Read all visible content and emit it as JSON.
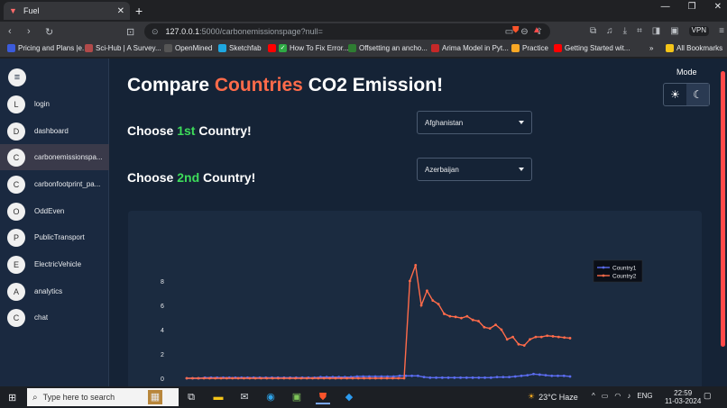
{
  "browser": {
    "tab_title": "Fuel",
    "url_host": "127.0.0.1",
    "url_rest": ":5000/carbonemissionspage?null=",
    "bookmarks": [
      "Pricing and Plans |e...",
      "Sci-Hub | A Survey...",
      "OpenMined",
      "Sketchfab",
      "How To Fix Error...",
      "Offsetting an ancho...",
      "Arima Model in Pyt...",
      "Practice",
      "Getting Started wit..."
    ],
    "all_bookmarks": "All Bookmarks",
    "vpn": "VPN"
  },
  "sidebar": {
    "items": [
      {
        "initial": "L",
        "label": "login"
      },
      {
        "initial": "D",
        "label": "dashboard"
      },
      {
        "initial": "C",
        "label": "carbonemissionspa..."
      },
      {
        "initial": "C",
        "label": "carbonfootprint_pa..."
      },
      {
        "initial": "O",
        "label": "OddEven"
      },
      {
        "initial": "P",
        "label": "PublicTransport"
      },
      {
        "initial": "E",
        "label": "ElectricVehicle"
      },
      {
        "initial": "A",
        "label": "analytics"
      },
      {
        "initial": "C",
        "label": "chat"
      }
    ]
  },
  "header": {
    "title_prefix": "Compare ",
    "title_highlight": "Countries",
    "title_suffix": " CO2 Emission!"
  },
  "choose1": {
    "prefix": "Choose ",
    "highlight": "1st",
    "suffix": " Country!",
    "selected": "Afghanistan"
  },
  "choose2": {
    "prefix": "Choose ",
    "highlight": "2nd",
    "suffix": " Country!",
    "selected": "Azerbaijan"
  },
  "mode": {
    "label": "Mode"
  },
  "chart_data": {
    "type": "line",
    "yticks": [
      "0",
      "2",
      "4",
      "6",
      "8"
    ],
    "ylim": [
      0,
      10
    ],
    "series": [
      {
        "name": "Country1",
        "color": "#5b6cf0",
        "values": [
          0.0,
          0.0,
          0.0,
          0.05,
          0.05,
          0.05,
          0.05,
          0.05,
          0.05,
          0.05,
          0.05,
          0.05,
          0.05,
          0.05,
          0.05,
          0.05,
          0.05,
          0.05,
          0.05,
          0.05,
          0.05,
          0.05,
          0.1,
          0.1,
          0.1,
          0.1,
          0.1,
          0.1,
          0.15,
          0.15,
          0.15,
          0.15,
          0.15,
          0.15,
          0.15,
          0.2,
          0.2,
          0.2,
          0.2,
          0.1,
          0.05,
          0.05,
          0.05,
          0.05,
          0.05,
          0.05,
          0.05,
          0.05,
          0.05,
          0.05,
          0.05,
          0.1,
          0.1,
          0.1,
          0.15,
          0.2,
          0.25,
          0.35,
          0.3,
          0.25,
          0.2,
          0.2,
          0.2,
          0.15
        ]
      },
      {
        "name": "Country2",
        "color": "#ff6b4a",
        "values": [
          0.0,
          0.0,
          0.0,
          0.0,
          0.0,
          0.0,
          0.0,
          0.0,
          0.0,
          0.0,
          0.0,
          0.0,
          0.0,
          0.0,
          0.0,
          0.0,
          0.0,
          0.0,
          0.0,
          0.0,
          0.0,
          0.0,
          0.0,
          0.0,
          0.0,
          0.0,
          0.0,
          0.0,
          0.0,
          0.0,
          0.0,
          0.0,
          0.0,
          0.0,
          0.0,
          0.0,
          0.0,
          0.0,
          0.0,
          8.0,
          9.3,
          6.0,
          7.2,
          6.4,
          6.1,
          5.3,
          5.1,
          5.05,
          4.95,
          5.1,
          4.8,
          4.7,
          4.2,
          4.1,
          4.4,
          4.0,
          3.2,
          3.4,
          2.8,
          2.7,
          3.2,
          3.4,
          3.4,
          3.5,
          3.45,
          3.4,
          3.35,
          3.3
        ]
      }
    ]
  }
}
